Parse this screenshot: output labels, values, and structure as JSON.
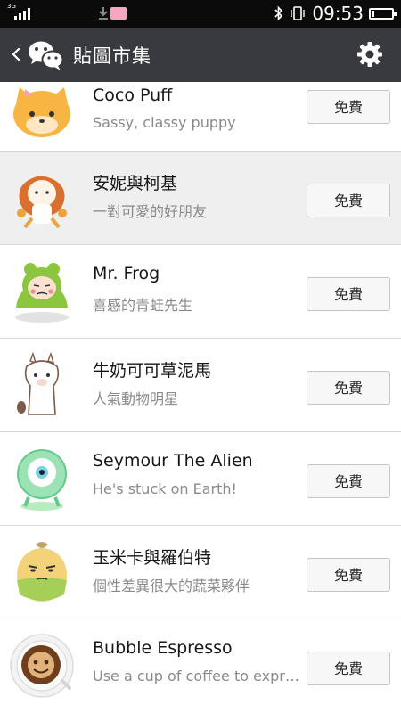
{
  "status_bar": {
    "network_type": "3G",
    "time": "09:53",
    "icons": [
      "signal-icon",
      "download-icon",
      "app-notification-icon",
      "bluetooth-icon",
      "vibrate-icon",
      "battery-icon"
    ]
  },
  "title_bar": {
    "title": "貼圖市集",
    "icons": [
      "back-icon",
      "wechat-logo-icon",
      "gear-icon"
    ]
  },
  "colors": {
    "title_bar": "#393a3f",
    "status_bar": "#0b0b0b",
    "highlight_row": "#efefef"
  },
  "sticker_list": [
    {
      "name": "Coco Puff",
      "description": "Sassy, classy puppy",
      "price": "免費",
      "thumbnail": "dog-sticker-icon"
    },
    {
      "name": "安妮與柯基",
      "description": "一對可愛的好朋友",
      "price": "免費",
      "thumbnail": "girl-sticker-icon"
    },
    {
      "name": "Mr. Frog",
      "description": "喜感的青蛙先生",
      "price": "免費",
      "thumbnail": "frog-sticker-icon"
    },
    {
      "name": "牛奶可可草泥馬",
      "description": "人氣動物明星",
      "price": "免費",
      "thumbnail": "alpaca-sticker-icon"
    },
    {
      "name": "Seymour The Alien",
      "description": "He's stuck on Earth!",
      "price": "免費",
      "thumbnail": "alien-sticker-icon"
    },
    {
      "name": "玉米卡與羅伯特",
      "description": "個性差異很大的蔬菜夥伴",
      "price": "免費",
      "thumbnail": "veggie-sticker-icon"
    },
    {
      "name": "Bubble Espresso",
      "description": "Use a cup of coffee to expr…",
      "price": "免費",
      "thumbnail": "coffee-sticker-icon"
    }
  ]
}
